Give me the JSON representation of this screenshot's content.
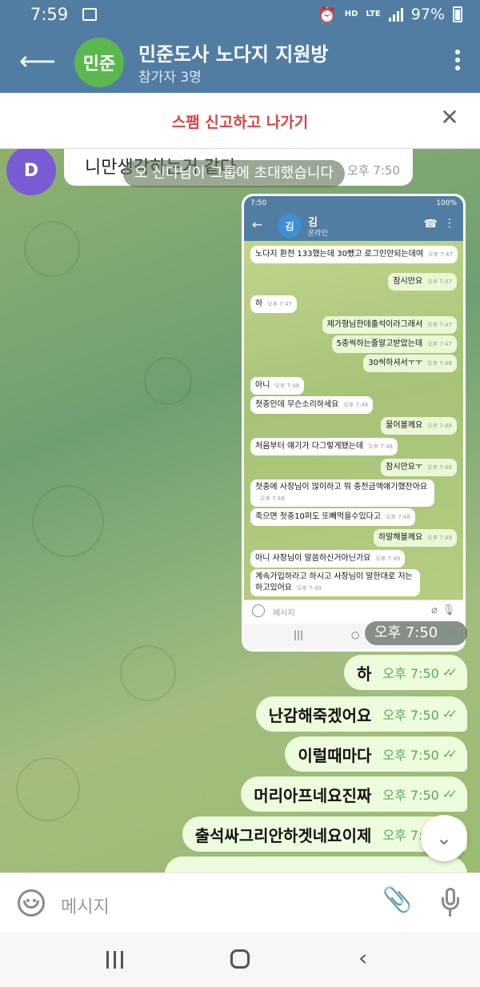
{
  "status_bar": {
    "time": "7:59",
    "net_hd": "HD",
    "net_lte": "LTE",
    "battery": "97%"
  },
  "header": {
    "avatar_text": "민준",
    "title": "민준도사 노다지 지원방",
    "subtitle": "참가자 3명",
    "accent_color": "#517da2"
  },
  "spam_bar": {
    "label": "스팸 신고하고 나가기"
  },
  "chat": {
    "incoming": {
      "avatar_letter": "D",
      "text": "니만생각하는거 같다",
      "time": "오후 7:50"
    },
    "service_message": "오 신다님이 그룹에 초대했습니다",
    "screenshot_bubble": {
      "time": "오후 7:50",
      "status_time": "7:50",
      "status_right": "100%",
      "contact_avatar": "김",
      "contact_name": "김",
      "contact_status": "온라인",
      "input_placeholder": "메시지",
      "messages": [
        {
          "dir": "in",
          "text": "노다지 환전 133했는데 30뺐고 로그인안되는데여",
          "time": "오후 7:47"
        },
        {
          "dir": "out",
          "text": "잠시만요",
          "time": "오후 7:47"
        },
        {
          "dir": "in",
          "text": "하",
          "time": "오후 7:47"
        },
        {
          "dir": "out",
          "text": "제가형님한데출석이라그래서",
          "time": "오후 7:47"
        },
        {
          "dir": "out",
          "text": "5충씩하는줄알고받았는데",
          "time": "오후 7:47"
        },
        {
          "dir": "out",
          "text": "30씩하셔서ㅜㅜ",
          "time": "오후 7:48"
        },
        {
          "dir": "in",
          "text": "아니",
          "time": "오후 7:48"
        },
        {
          "dir": "in",
          "text": "첫충인데 무슨소리하세요",
          "time": "오후 7:48"
        },
        {
          "dir": "out",
          "text": "물어볼께요",
          "time": "오후 7:48"
        },
        {
          "dir": "in",
          "text": "처음부터 얘기가 다그렇게됐는데",
          "time": "오후 7:48"
        },
        {
          "dir": "out",
          "text": "잠시만요ㅜ",
          "time": "오후 7:48"
        },
        {
          "dir": "in",
          "text": "첫충에 사장님이 많이하고 뭐 충전금액얘기했잔아요",
          "time": "오후 7:48"
        },
        {
          "dir": "in",
          "text": "죽으면 첫충10퍼도 또빼먹을수있다고",
          "time": "오후 7:48"
        },
        {
          "dir": "out",
          "text": "하말해볼께요",
          "time": "오후 7:49"
        },
        {
          "dir": "in",
          "text": "아니 사장님이 말씀하신거아닌가요",
          "time": "오후 7:49"
        },
        {
          "dir": "in",
          "text": "계속가입하라고 하시고 사장님이 말한대로 저는하고있어요",
          "time": "오후 7:49"
        }
      ]
    },
    "outgoing": [
      {
        "text": "하",
        "time": "오후 7:50"
      },
      {
        "text": "난감해죽겠어요",
        "time": "오후 7:50"
      },
      {
        "text": "이럴때마다",
        "time": "오후 7:50"
      },
      {
        "text": "머리아프네요진짜",
        "time": "오후 7:50"
      },
      {
        "text": "출석싸그리안하겟네요이제",
        "time": "오후 7:50"
      }
    ]
  },
  "input_bar": {
    "placeholder": "메시지"
  }
}
